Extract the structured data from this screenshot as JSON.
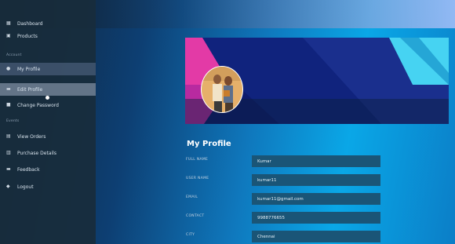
{
  "sidebar": {
    "items": [
      {
        "label": "Dashboard",
        "icon": "grid-icon"
      },
      {
        "label": "Products",
        "icon": "box-icon"
      }
    ],
    "section_account": "Account",
    "account_items": [
      {
        "label": "My Profile",
        "icon": "user-icon"
      },
      {
        "label": "Edit Profile",
        "icon": "edit-icon"
      },
      {
        "label": "Change Password",
        "icon": "lock-icon"
      }
    ],
    "section_events": "Events",
    "event_items": [
      {
        "label": "View Orders",
        "icon": "list-icon"
      },
      {
        "label": "Purchase Details",
        "icon": "receipt-icon"
      },
      {
        "label": "Feedback",
        "icon": "chat-icon"
      },
      {
        "label": "Logout",
        "icon": "logout-icon"
      }
    ]
  },
  "main": {
    "title": "My Profile",
    "fields": [
      {
        "label": "Full Name",
        "value": "Kumar"
      },
      {
        "label": "User Name",
        "value": "kumar11"
      },
      {
        "label": "Email",
        "value": "kumar11@gmail.com"
      },
      {
        "label": "Contact",
        "value": "9988776655"
      },
      {
        "label": "City",
        "value": "Chennai"
      }
    ]
  },
  "colors": {
    "banner_pink": "#e33aa6",
    "banner_navy": "#0d1a6d",
    "banner_cyan": "#46d3f2",
    "field_bg": "#1a5577"
  }
}
